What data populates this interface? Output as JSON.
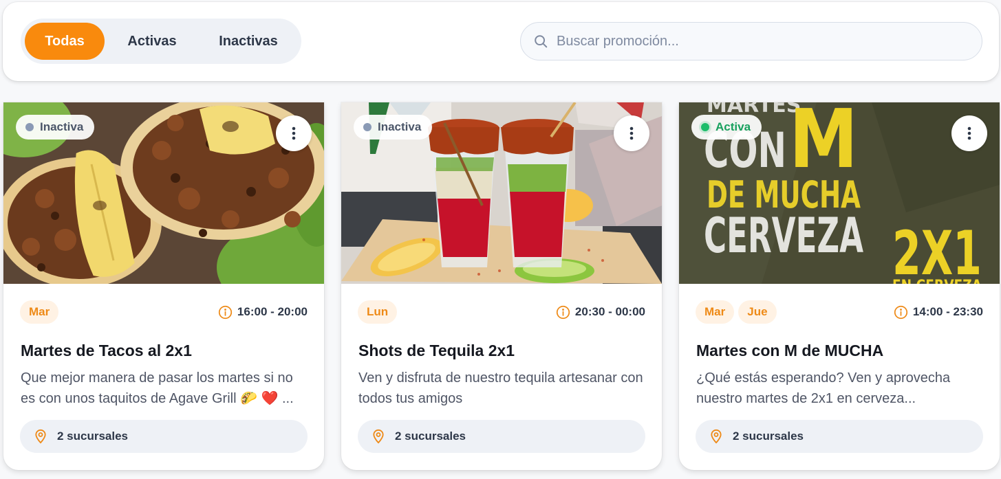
{
  "filters": {
    "tabs": [
      {
        "label": "Todas",
        "selected": true
      },
      {
        "label": "Activas",
        "selected": false
      },
      {
        "label": "Inactivas",
        "selected": false
      }
    ],
    "search": {
      "placeholder": "Buscar promoción...",
      "icon": "search-icon"
    }
  },
  "colors": {
    "accent": "#f98a0d",
    "active": "#1cbd6a",
    "inactive": "#8a9ab5"
  },
  "promotions": [
    {
      "status": "Inactiva",
      "days": [
        "Mar"
      ],
      "time": "16:00 - 20:00",
      "title": "Martes de Tacos al 2x1",
      "description": "Que mejor manera de pasar los martes si no es con unos taquitos de Agave Grill 🌮 ❤️ ...",
      "branches": "2 sucursales"
    },
    {
      "status": "Inactiva",
      "days": [
        "Lun"
      ],
      "time": "20:30 - 00:00",
      "title": "Shots de Tequila 2x1",
      "description": "Ven y disfruta de nuestro tequila artesanar con todos tus amigos",
      "branches": "2 sucursales"
    },
    {
      "status": "Activa",
      "days": [
        "Mar",
        "Jue"
      ],
      "time": "14:00 - 23:30",
      "title": "Martes con M de MUCHA",
      "description": "¿Qué estás esperando? Ven y aprovecha nuestro martes de 2x1 en cerveza...",
      "branches": "2 sucursales",
      "image_text": {
        "line1": "MARTES",
        "line2a": "CON",
        "line2b": "M",
        "line3": "DE MUCHA",
        "line4": "CERVEZA",
        "promo": "2X1",
        "promo_sub": "EN CERVEZA"
      }
    }
  ]
}
